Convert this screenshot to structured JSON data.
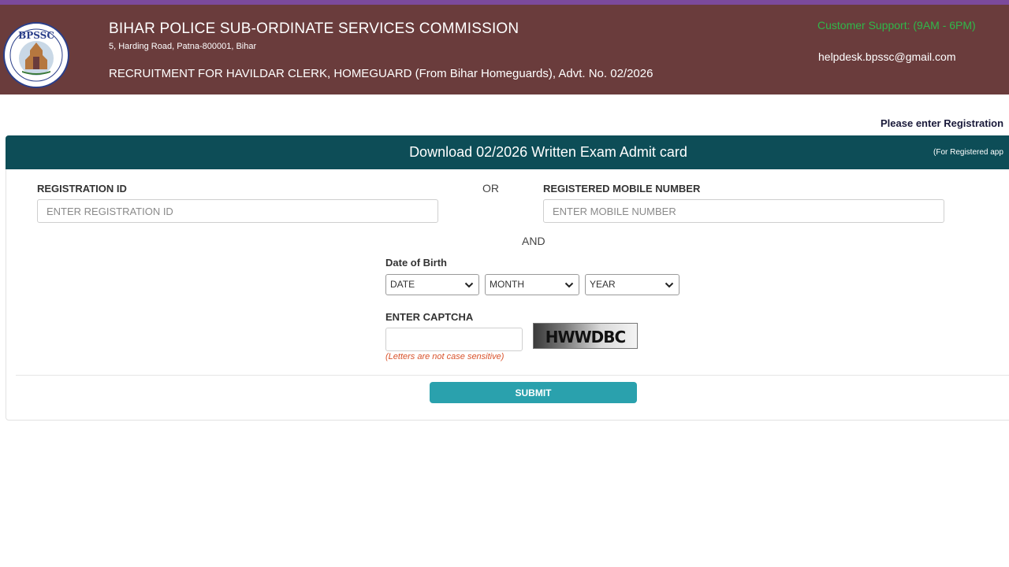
{
  "header": {
    "org_name": "BIHAR POLICE SUB-ORDINATE SERVICES COMMISSION",
    "address": "5, Harding Road, Patna-800001, Bihar",
    "recruitment": "RECRUITMENT FOR HAVILDAR CLERK, HOMEGUARD (From Bihar Homeguards), Advt. No. 02/2026",
    "support": "Customer Support: (9AM - 6PM)",
    "helpdesk_email": "helpdesk.bpssc@gmail.com",
    "logo_text": "BPSSC",
    "colors": {
      "top_strip": "#7b4a9c",
      "background": "#6a3c3c",
      "support_text": "#2fb84a"
    }
  },
  "notice": "Please enter Registration",
  "card": {
    "title": "Download 02/2026 Written Exam Admit card",
    "note": "(For Registered app",
    "header_color": "#0d4d57"
  },
  "form": {
    "registration_label": "REGISTRATION ID",
    "registration_placeholder": "ENTER REGISTRATION ID",
    "or_text": "OR",
    "mobile_label": "REGISTERED MOBILE NUMBER",
    "mobile_placeholder": "ENTER MOBILE NUMBER",
    "and_text": "AND",
    "dob_label": "Date of Birth",
    "date_select": "DATE",
    "month_select": "MONTH",
    "year_select": "YEAR",
    "captcha_label": "ENTER CAPTCHA",
    "captcha_image_text": "HWWDBC",
    "captcha_hint": "(Letters are not case sensitive)",
    "submit_label": "SUBMIT",
    "submit_color": "#2aa1ad",
    "icons": {
      "chevron": "chevron-down-icon"
    }
  }
}
